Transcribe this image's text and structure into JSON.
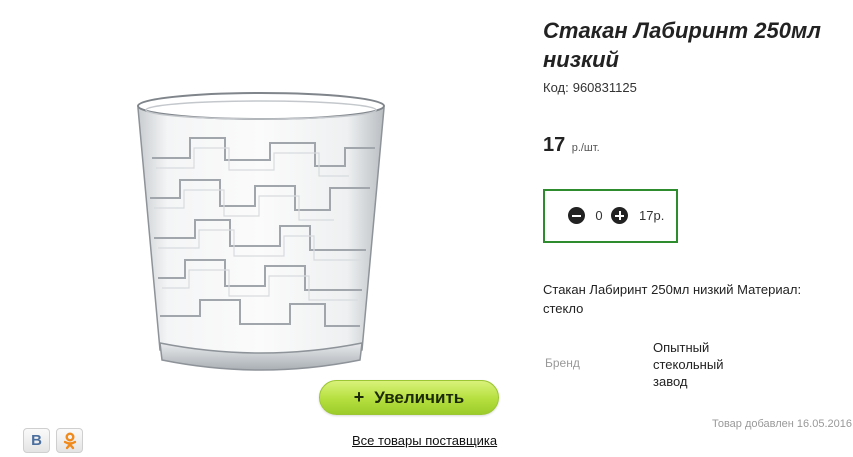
{
  "product": {
    "title": "Стакан Лабиринт 250мл низкий",
    "code_label": "Код:",
    "code_value": "960831125",
    "price_value": "17",
    "price_unit": "р./шт.",
    "quantity": "0",
    "quantity_total": "17р.",
    "description": "Стакан Лабиринт 250мл низкий Материал: стекло",
    "brand_label": "Бренд",
    "brand_value": "Опытный стекольный завод",
    "added_date": "Товар добавлен 16.05.2016"
  },
  "actions": {
    "zoom_plus": "+",
    "zoom_label": "Увеличить",
    "all_products_link": "Все товары поставщика"
  },
  "social": {
    "vk_letter": "В",
    "icons": [
      "vk-icon",
      "odnoklassniki-icon"
    ]
  },
  "colors": {
    "accent_green": "#9ccc2a",
    "qty_border": "#2e8b2e",
    "ok_orange": "#f08a1c",
    "vk_blue": "#4b6f9e"
  }
}
